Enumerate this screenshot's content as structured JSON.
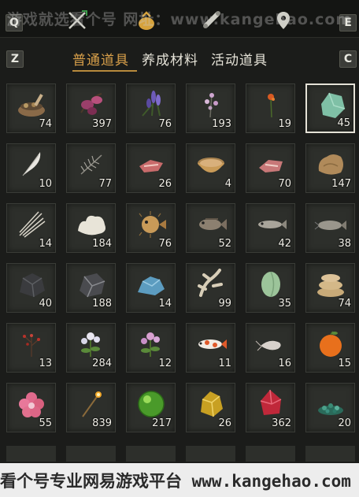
{
  "topbar": {
    "left_key": "Q",
    "right_key": "E",
    "watermark": "游戏就选看个号 网址：www.kangehao.com"
  },
  "tabbar": {
    "left_key": "Z",
    "right_key": "C",
    "tabs": [
      {
        "label": "普通道具",
        "active": true
      },
      {
        "label": "养成材料",
        "active": false
      },
      {
        "label": "活动道具",
        "active": false
      }
    ]
  },
  "items": [
    {
      "icon": "herb-bowl-icon",
      "qty": "74"
    },
    {
      "icon": "purple-flower-icon",
      "qty": "397"
    },
    {
      "icon": "lavender-icon",
      "qty": "76"
    },
    {
      "icon": "small-flower-icon",
      "qty": "193"
    },
    {
      "icon": "red-sprig-icon",
      "qty": "19"
    },
    {
      "icon": "jade-stone-icon",
      "qty": "45",
      "selected": true
    },
    {
      "icon": "white-feather-icon",
      "qty": "10"
    },
    {
      "icon": "grey-feather-icon",
      "qty": "77"
    },
    {
      "icon": "raw-meat-icon",
      "qty": "26"
    },
    {
      "icon": "soup-bowl-icon",
      "qty": "4"
    },
    {
      "icon": "fish-meat-icon",
      "qty": "70"
    },
    {
      "icon": "fur-pelt-icon",
      "qty": "147"
    },
    {
      "icon": "quills-icon",
      "qty": "14"
    },
    {
      "icon": "white-fleece-icon",
      "qty": "184"
    },
    {
      "icon": "pufferfish-icon",
      "qty": "76"
    },
    {
      "icon": "rockfish-icon",
      "qty": "52"
    },
    {
      "icon": "grey-fish-icon",
      "qty": "42"
    },
    {
      "icon": "catfish-icon",
      "qty": "38"
    },
    {
      "icon": "dark-ore-icon",
      "qty": "40"
    },
    {
      "icon": "iron-ore-icon",
      "qty": "188"
    },
    {
      "icon": "blue-ore-icon",
      "qty": "14"
    },
    {
      "icon": "bone-coral-icon",
      "qty": "99"
    },
    {
      "icon": "green-melon-icon",
      "qty": "35"
    },
    {
      "icon": "sandbags-icon",
      "qty": "74"
    },
    {
      "icon": "red-berry-twig-icon",
      "qty": "13"
    },
    {
      "icon": "white-flower-herb-icon",
      "qty": "284"
    },
    {
      "icon": "pink-flower-herb-icon",
      "qty": "12"
    },
    {
      "icon": "koi-fish-icon",
      "qty": "11"
    },
    {
      "icon": "shrimp-icon",
      "qty": "16"
    },
    {
      "icon": "orange-fruit-icon",
      "qty": "15"
    },
    {
      "icon": "pink-blossom-icon",
      "qty": "55"
    },
    {
      "icon": "incense-stick-icon",
      "qty": "839"
    },
    {
      "icon": "green-orb-icon",
      "qty": "217"
    },
    {
      "icon": "gold-nugget-icon",
      "qty": "26"
    },
    {
      "icon": "red-crystal-icon",
      "qty": "362"
    },
    {
      "icon": "green-gravel-icon",
      "qty": "20"
    }
  ],
  "bottom_watermark": "看个号专业网易游戏平台 www.kangehao.com"
}
